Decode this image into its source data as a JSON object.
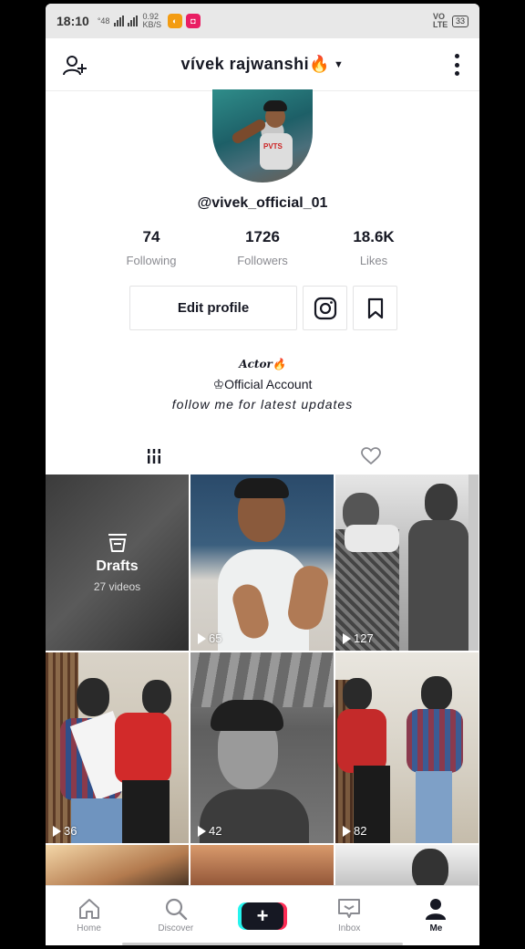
{
  "status_bar": {
    "time": "18:10",
    "net_small": "°48",
    "speed_top": "0.92",
    "speed_bottom": "KB/S",
    "volte": "VO LTE",
    "battery": "33"
  },
  "header": {
    "title": "vívek rajwanshi🔥",
    "add_user_icon": "person-add-icon",
    "menu_icon": "more-vertical-icon"
  },
  "profile": {
    "handle": "@vivek_official_01",
    "stats": [
      {
        "value": "74",
        "label": "Following"
      },
      {
        "value": "1726",
        "label": "Followers"
      },
      {
        "value": "18.6K",
        "label": "Likes"
      }
    ],
    "edit_label": "Edit profile",
    "bio": {
      "line1": "Actor🔥",
      "line2": "♔Official Account",
      "line3": "follow me for latest updates"
    }
  },
  "tabs": {
    "videos_icon": "grid-icon",
    "liked_icon": "heart-icon"
  },
  "grid": {
    "drafts": {
      "label": "Drafts",
      "count": "27 videos"
    },
    "videos": [
      {
        "views": "65"
      },
      {
        "views": "127"
      },
      {
        "views": "36"
      },
      {
        "views": "42"
      },
      {
        "views": "82"
      }
    ]
  },
  "nav": [
    {
      "label": "Home",
      "icon": "home-icon"
    },
    {
      "label": "Discover",
      "icon": "search-icon"
    },
    {
      "label": "",
      "icon": "plus-icon"
    },
    {
      "label": "Inbox",
      "icon": "inbox-icon"
    },
    {
      "label": "Me",
      "icon": "profile-icon"
    }
  ],
  "colors": {
    "accent_cyan": "#25f4ee",
    "accent_red": "#fe2c55",
    "text": "#161823",
    "muted": "#8a8b91"
  }
}
